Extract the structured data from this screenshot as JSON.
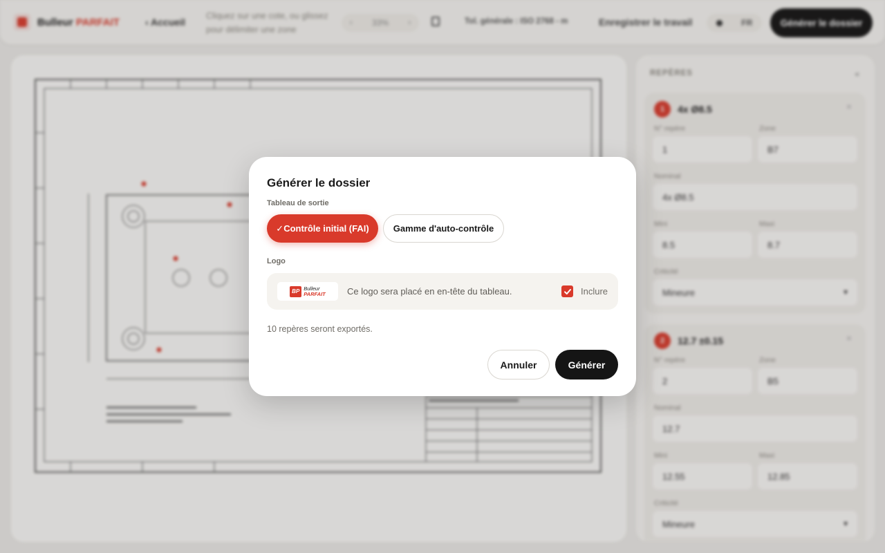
{
  "app": {
    "brand_main": "Bulleur",
    "brand_accent": "PARFAIT",
    "nav_home": "‹ Accueil",
    "hint": "Cliquez sur une cote, ou glissez pour délimiter une zone",
    "zoom": {
      "minus": "‹",
      "value": "33%",
      "plus": "›"
    },
    "tolerance": "Tol. générale : ISO 2768 - m",
    "save_work": "Enregistrer le travail",
    "language": "FR",
    "generate_top": "Générer le dossier"
  },
  "sidebar": {
    "title": "REPÈRES",
    "collapse": "«",
    "cards": [
      {
        "num": "1",
        "title": "4x Ø8.5",
        "close": "×",
        "labels": {
          "repere": "N° repère",
          "zone": "Zone",
          "nominal": "Nominal",
          "mini": "Mini",
          "maxi": "Maxi",
          "criticite": "Criticité"
        },
        "values": {
          "repere": "1",
          "zone": "B7",
          "nominal": "4x Ø8.5",
          "mini": "8.5",
          "maxi": "8.7",
          "criticite": "Mineure"
        }
      },
      {
        "num": "2",
        "title": "12.7 ±0.15",
        "close": "×",
        "labels": {
          "repere": "N° repère",
          "zone": "Zone",
          "nominal": "Nominal",
          "mini": "Mini",
          "maxi": "Maxi",
          "criticite": "Criticité"
        },
        "values": {
          "repere": "2",
          "zone": "B5",
          "nominal": "12.7",
          "mini": "12.55",
          "maxi": "12.85",
          "criticite": "Mineure"
        }
      }
    ]
  },
  "modal": {
    "title": "Générer le dossier",
    "output_label": "Tableau de sortie",
    "options": [
      {
        "label": "✓Contrôle initial (FAI)",
        "selected": true
      },
      {
        "label": "Gamme d'auto-contrôle",
        "selected": false
      }
    ],
    "logo_label": "Logo",
    "logo_text_1": "Bulleur",
    "logo_text_2": "PARFAIT",
    "logo_mark": "BP",
    "logo_description": "Ce logo sera placé en en-tête du tableau.",
    "include_label": "Inclure",
    "include_checked": true,
    "export_note": "10 repères seront exportés.",
    "cancel": "Annuler",
    "generate": "Générer"
  },
  "colors": {
    "accent": "#d93a2b",
    "dark": "#151515",
    "surface": "#f5f3ef"
  },
  "icons": [
    "brand-icon",
    "fit-page-icon",
    "dark-mode-icon",
    "chevron-down-icon",
    "check-icon",
    "close-icon"
  ]
}
